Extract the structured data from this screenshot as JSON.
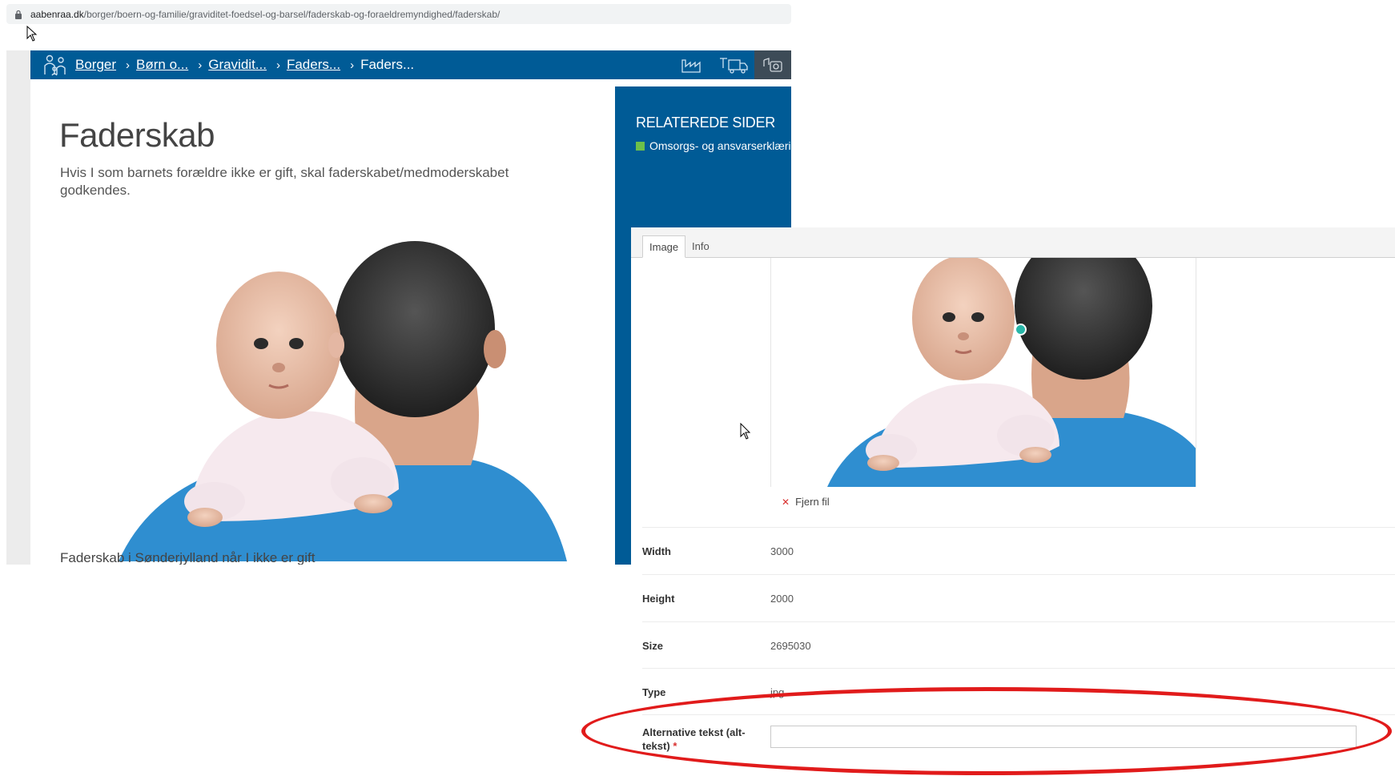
{
  "browser": {
    "url_domain": "aabenraa.dk",
    "url_path": "/borger/boern-og-familie/graviditet-foedsel-og-barsel/faderskab-og-foraeldremyndighed/faderskab/"
  },
  "site": {
    "breadcrumbs": [
      {
        "label": "Borger"
      },
      {
        "label": "Børn o..."
      },
      {
        "label": "Gravidit..."
      },
      {
        "label": "Faders..."
      },
      {
        "label": "Faders..."
      }
    ],
    "title": "Faderskab",
    "lead": "Hvis I som barnets forældre ikke er gift, skal faderskabet/medmoderskabet godkendes.",
    "subheading": "Faderskab i Sønderjylland når I ikke er gift",
    "related": {
      "title": "RELATEREDE SIDER",
      "link": "Omsorgs- og ansvarserklæri"
    },
    "hero_image_alt": ""
  },
  "cms": {
    "tabs": [
      {
        "label": "Image"
      },
      {
        "label": "Info"
      }
    ],
    "remove_label": "Fjern fil",
    "fields": [
      {
        "label": "Width",
        "value": "3000"
      },
      {
        "label": "Height",
        "value": "2000"
      },
      {
        "label": "Size",
        "value": "2695030"
      },
      {
        "label": "Type",
        "value": "jpg"
      }
    ],
    "alt_text": {
      "label": "Alternative tekst (alt-tekst)",
      "required_mark": "*",
      "value": ""
    }
  },
  "colors": {
    "brand_blue": "#005b96",
    "focus_dot": "#29b6a8",
    "highlight_ring": "#e11b1b"
  }
}
